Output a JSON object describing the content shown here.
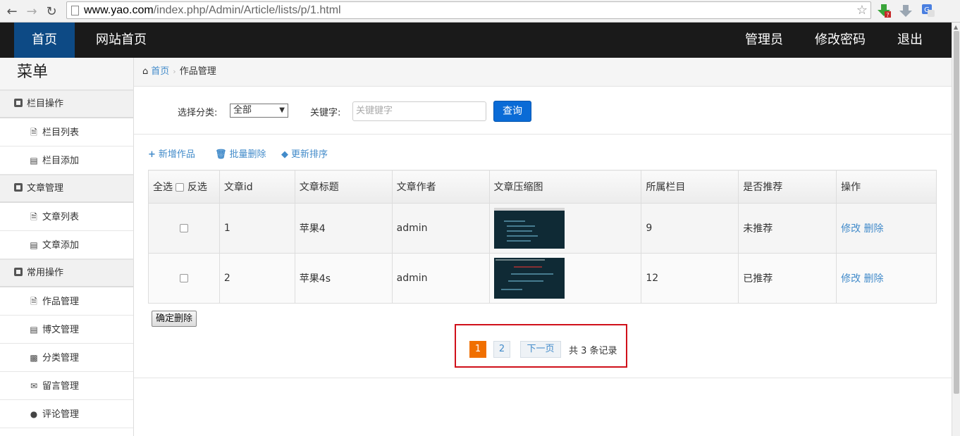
{
  "browser": {
    "url_host": "www.yao.com",
    "url_path": "/index.php/Admin/Article/lists/p/1.html"
  },
  "topnav": {
    "home": "首页",
    "site_home": "网站首页",
    "admin": "管理员",
    "change_password": "修改密码",
    "logout": "退出"
  },
  "sidebar": {
    "title": "菜单",
    "groups": [
      {
        "label": "栏目操作",
        "items": [
          "栏目列表",
          "栏目添加"
        ]
      },
      {
        "label": "文章管理",
        "items": [
          "文章列表",
          "文章添加"
        ]
      },
      {
        "label": "常用操作",
        "items": [
          "作品管理",
          "博文管理",
          "分类管理",
          "留言管理",
          "评论管理"
        ]
      }
    ]
  },
  "breadcrumb": {
    "home": "首页",
    "current": "作品管理"
  },
  "search": {
    "category_label": "选择分类:",
    "category_value": "全部",
    "keyword_label": "关键字:",
    "keyword_placeholder": "关键键字",
    "query_button": "查询"
  },
  "actions": {
    "add": "新增作品",
    "batch_delete": "批量删除",
    "update_sort": "更新排序"
  },
  "table": {
    "headers": {
      "select_all": "全选",
      "invert": "反选",
      "id": "文章id",
      "title": "文章标题",
      "author": "文章作者",
      "thumb": "文章压缩图",
      "column": "所属栏目",
      "recommend": "是否推荐",
      "ops": "操作"
    },
    "rows": [
      {
        "id": "1",
        "title": "苹果4",
        "author": "admin",
        "column": "9",
        "recommend": "未推荐",
        "edit": "修改",
        "delete": "删除"
      },
      {
        "id": "2",
        "title": "苹果4s",
        "author": "admin",
        "column": "12",
        "recommend": "已推荐",
        "edit": "修改",
        "delete": "删除"
      }
    ]
  },
  "confirm_delete": "确定删除",
  "pager": {
    "page1": "1",
    "page2": "2",
    "next": "下一页",
    "total": "共 3 条记录"
  },
  "colors": {
    "topbar": "#1a1a1a",
    "topbar_active": "#0d4a85",
    "link": "#428bca",
    "query_button": "#0a6bd6",
    "pager_current": "#f06f00",
    "highlight_border": "#d0101a"
  }
}
